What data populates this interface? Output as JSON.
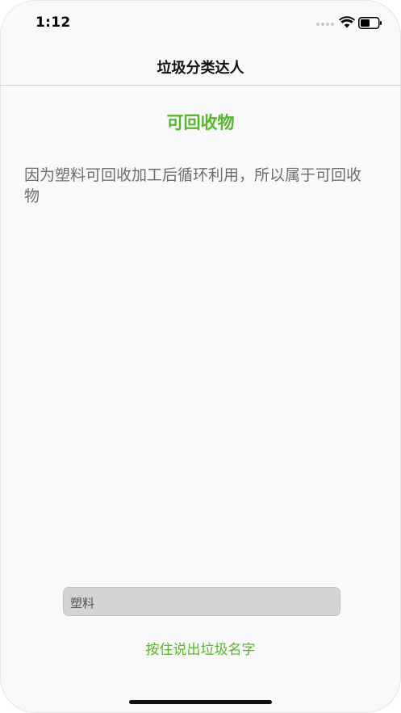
{
  "status_bar": {
    "time": "1:12"
  },
  "nav": {
    "title": "垃圾分类达人"
  },
  "result": {
    "category": "可回收物",
    "reason": "因为塑料可回收加工后循环利用，所以属于可回收物"
  },
  "input": {
    "value": "塑料"
  },
  "voice": {
    "button_label": "按住说出垃圾名字"
  },
  "colors": {
    "accent": "#55b72a",
    "body_text": "#6e6e6e",
    "background": "#f9f9f9"
  }
}
